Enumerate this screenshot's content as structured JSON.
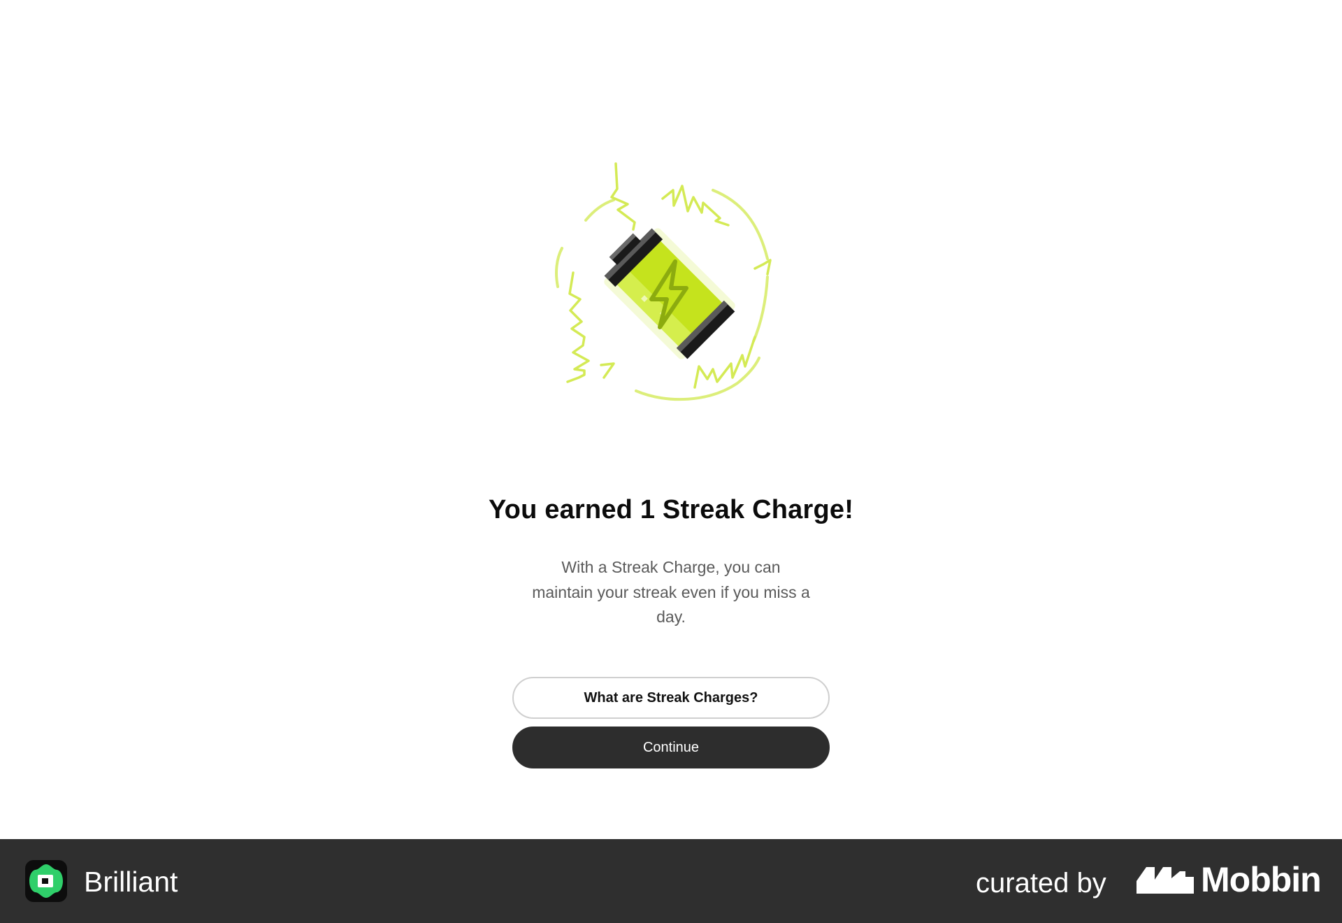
{
  "modal": {
    "title": "You earned 1 Streak Charge!",
    "description": "With a Streak Charge, you can maintain your streak even if you miss a day.",
    "illustration_icon": "streak-charge-battery-icon",
    "secondary_button_label": "What are Streak Charges?",
    "primary_button_label": "Continue"
  },
  "footer": {
    "app_name": "Brilliant",
    "app_logo_icon": "brilliant-logo-icon",
    "curated_label": "curated by",
    "brand_name": "Mobbin",
    "brand_logo_icon": "mobbin-logo-icon"
  },
  "colors": {
    "accent_lime": "#c8e62a",
    "lightning_ring": "#dcee7a",
    "primary_button_bg": "#2d2d2d",
    "footer_bg": "#2f2f2f",
    "brilliant_green": "#2fcf6a"
  }
}
